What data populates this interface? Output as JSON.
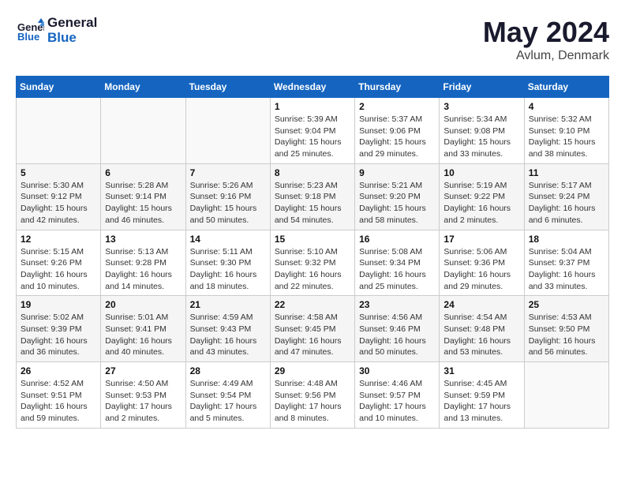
{
  "header": {
    "logo_line1": "General",
    "logo_line2": "Blue",
    "month_year": "May 2024",
    "location": "Avlum, Denmark"
  },
  "days_of_week": [
    "Sunday",
    "Monday",
    "Tuesday",
    "Wednesday",
    "Thursday",
    "Friday",
    "Saturday"
  ],
  "weeks": [
    [
      {
        "date": "",
        "info": ""
      },
      {
        "date": "",
        "info": ""
      },
      {
        "date": "",
        "info": ""
      },
      {
        "date": "1",
        "info": "Sunrise: 5:39 AM\nSunset: 9:04 PM\nDaylight: 15 hours\nand 25 minutes."
      },
      {
        "date": "2",
        "info": "Sunrise: 5:37 AM\nSunset: 9:06 PM\nDaylight: 15 hours\nand 29 minutes."
      },
      {
        "date": "3",
        "info": "Sunrise: 5:34 AM\nSunset: 9:08 PM\nDaylight: 15 hours\nand 33 minutes."
      },
      {
        "date": "4",
        "info": "Sunrise: 5:32 AM\nSunset: 9:10 PM\nDaylight: 15 hours\nand 38 minutes."
      }
    ],
    [
      {
        "date": "5",
        "info": "Sunrise: 5:30 AM\nSunset: 9:12 PM\nDaylight: 15 hours\nand 42 minutes."
      },
      {
        "date": "6",
        "info": "Sunrise: 5:28 AM\nSunset: 9:14 PM\nDaylight: 15 hours\nand 46 minutes."
      },
      {
        "date": "7",
        "info": "Sunrise: 5:26 AM\nSunset: 9:16 PM\nDaylight: 15 hours\nand 50 minutes."
      },
      {
        "date": "8",
        "info": "Sunrise: 5:23 AM\nSunset: 9:18 PM\nDaylight: 15 hours\nand 54 minutes."
      },
      {
        "date": "9",
        "info": "Sunrise: 5:21 AM\nSunset: 9:20 PM\nDaylight: 15 hours\nand 58 minutes."
      },
      {
        "date": "10",
        "info": "Sunrise: 5:19 AM\nSunset: 9:22 PM\nDaylight: 16 hours\nand 2 minutes."
      },
      {
        "date": "11",
        "info": "Sunrise: 5:17 AM\nSunset: 9:24 PM\nDaylight: 16 hours\nand 6 minutes."
      }
    ],
    [
      {
        "date": "12",
        "info": "Sunrise: 5:15 AM\nSunset: 9:26 PM\nDaylight: 16 hours\nand 10 minutes."
      },
      {
        "date": "13",
        "info": "Sunrise: 5:13 AM\nSunset: 9:28 PM\nDaylight: 16 hours\nand 14 minutes."
      },
      {
        "date": "14",
        "info": "Sunrise: 5:11 AM\nSunset: 9:30 PM\nDaylight: 16 hours\nand 18 minutes."
      },
      {
        "date": "15",
        "info": "Sunrise: 5:10 AM\nSunset: 9:32 PM\nDaylight: 16 hours\nand 22 minutes."
      },
      {
        "date": "16",
        "info": "Sunrise: 5:08 AM\nSunset: 9:34 PM\nDaylight: 16 hours\nand 25 minutes."
      },
      {
        "date": "17",
        "info": "Sunrise: 5:06 AM\nSunset: 9:36 PM\nDaylight: 16 hours\nand 29 minutes."
      },
      {
        "date": "18",
        "info": "Sunrise: 5:04 AM\nSunset: 9:37 PM\nDaylight: 16 hours\nand 33 minutes."
      }
    ],
    [
      {
        "date": "19",
        "info": "Sunrise: 5:02 AM\nSunset: 9:39 PM\nDaylight: 16 hours\nand 36 minutes."
      },
      {
        "date": "20",
        "info": "Sunrise: 5:01 AM\nSunset: 9:41 PM\nDaylight: 16 hours\nand 40 minutes."
      },
      {
        "date": "21",
        "info": "Sunrise: 4:59 AM\nSunset: 9:43 PM\nDaylight: 16 hours\nand 43 minutes."
      },
      {
        "date": "22",
        "info": "Sunrise: 4:58 AM\nSunset: 9:45 PM\nDaylight: 16 hours\nand 47 minutes."
      },
      {
        "date": "23",
        "info": "Sunrise: 4:56 AM\nSunset: 9:46 PM\nDaylight: 16 hours\nand 50 minutes."
      },
      {
        "date": "24",
        "info": "Sunrise: 4:54 AM\nSunset: 9:48 PM\nDaylight: 16 hours\nand 53 minutes."
      },
      {
        "date": "25",
        "info": "Sunrise: 4:53 AM\nSunset: 9:50 PM\nDaylight: 16 hours\nand 56 minutes."
      }
    ],
    [
      {
        "date": "26",
        "info": "Sunrise: 4:52 AM\nSunset: 9:51 PM\nDaylight: 16 hours\nand 59 minutes."
      },
      {
        "date": "27",
        "info": "Sunrise: 4:50 AM\nSunset: 9:53 PM\nDaylight: 17 hours\nand 2 minutes."
      },
      {
        "date": "28",
        "info": "Sunrise: 4:49 AM\nSunset: 9:54 PM\nDaylight: 17 hours\nand 5 minutes."
      },
      {
        "date": "29",
        "info": "Sunrise: 4:48 AM\nSunset: 9:56 PM\nDaylight: 17 hours\nand 8 minutes."
      },
      {
        "date": "30",
        "info": "Sunrise: 4:46 AM\nSunset: 9:57 PM\nDaylight: 17 hours\nand 10 minutes."
      },
      {
        "date": "31",
        "info": "Sunrise: 4:45 AM\nSunset: 9:59 PM\nDaylight: 17 hours\nand 13 minutes."
      },
      {
        "date": "",
        "info": ""
      }
    ]
  ]
}
